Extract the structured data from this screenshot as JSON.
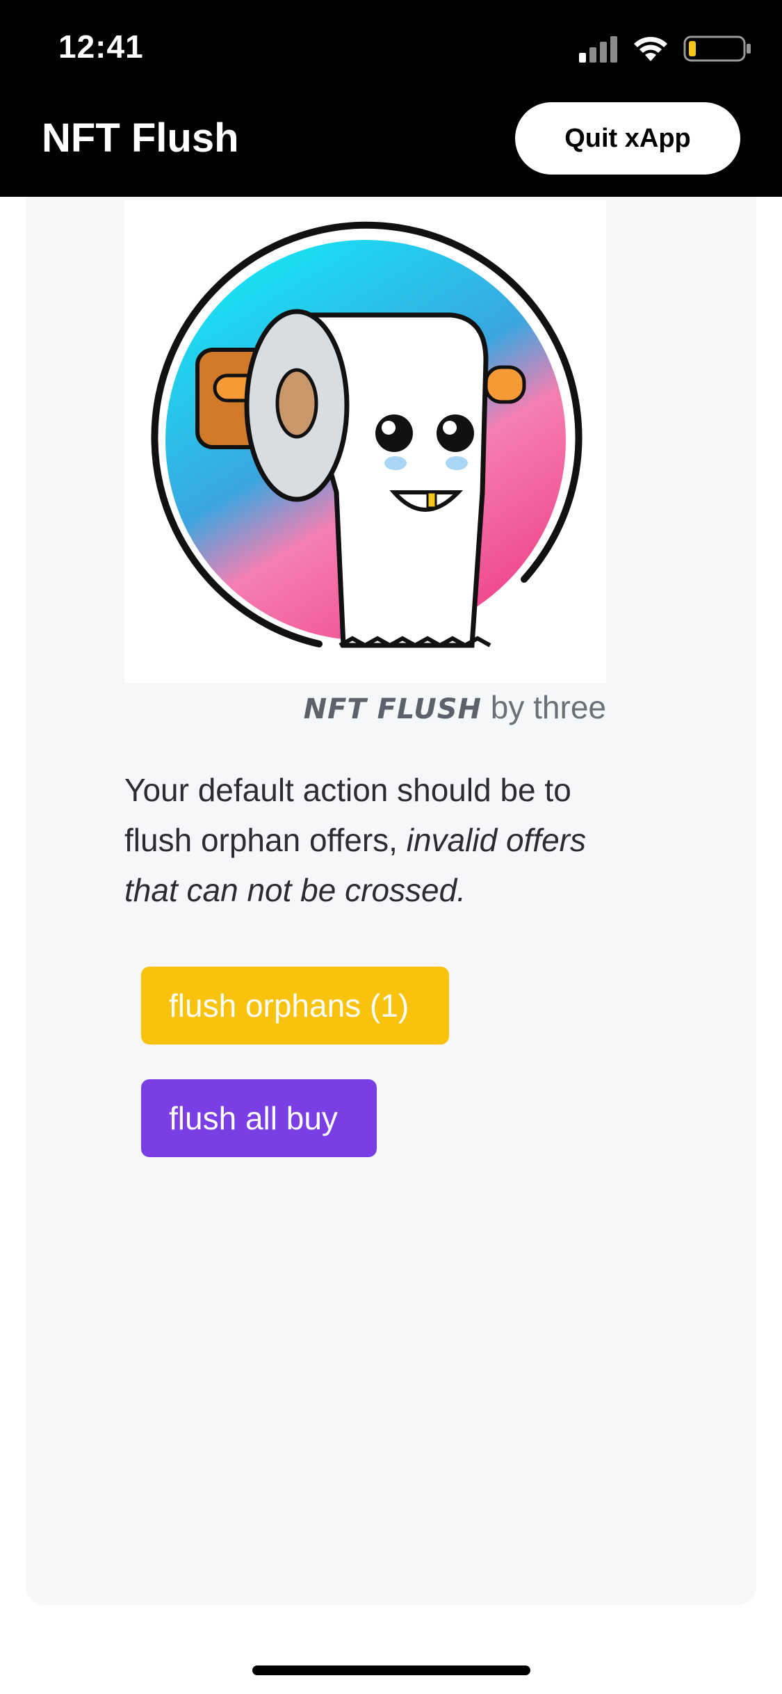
{
  "status_bar": {
    "time": "12:41",
    "icons": [
      "signal-icon",
      "wifi-icon",
      "battery-icon"
    ]
  },
  "header": {
    "title": "NFT Flush",
    "quit_label": "Quit xApp"
  },
  "hero": {
    "image": "toilet-paper-mascot-logo"
  },
  "credit": {
    "brand": "NFT FLUSH",
    "suffix": "by three"
  },
  "description": {
    "plain": "Your default action should be to flush orphan offers,",
    "emphasis": "invalid offers that can not be crossed."
  },
  "actions": {
    "flush_orphans": "flush orphans (1)",
    "flush_all_buy": "flush all buy"
  },
  "colors": {
    "topbar": "#000000",
    "card_background": "#f6f7f9",
    "orphans_button": "#f9c20d",
    "buy_button": "#7a3fe4",
    "battery_level": "#f5c518"
  }
}
